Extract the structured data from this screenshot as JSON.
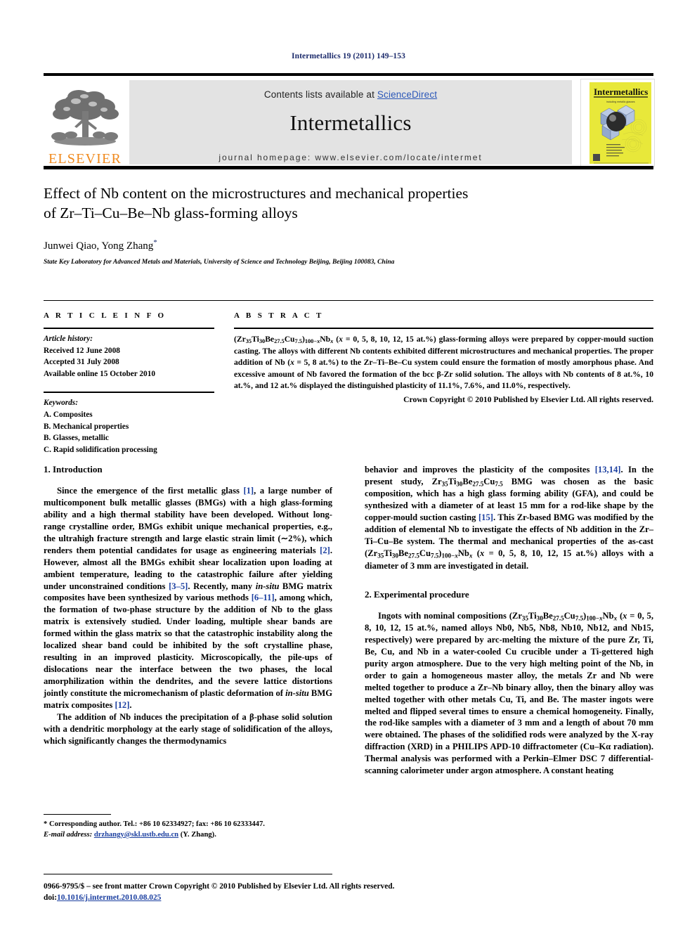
{
  "running_head": "Intermetallics 19 (2011) 149–153",
  "masthead": {
    "contents_prefix": "Contents lists available at ",
    "sciencedirect": "ScienceDirect",
    "journal_name": "Intermetallics",
    "homepage": "journal homepage: www.elsevier.com/locate/intermet",
    "publisher_logo_text": "ELSEVIER",
    "cover": {
      "title": "Intermetallics",
      "subtitle": "including metallic glasses",
      "bg_color": "#E8E83A",
      "cube_color": "#9DB3D8"
    }
  },
  "article": {
    "title_line1": "Effect of Nb content on the microstructures and mechanical properties",
    "title_line2": "of Zr–Ti–Cu–Be–Nb glass-forming alloys",
    "authors": "Junwei Qiao, Yong Zhang",
    "corresponding_marker": "*",
    "affiliation": "State Key Laboratory for Advanced Metals and Materials, University of Science and Technology Beijing, Beijing 100083, China"
  },
  "article_info": {
    "heading": "A R T I C L E    I N F O",
    "history_label": "Article history:",
    "history": [
      "Received 12 June 2008",
      "Accepted 31 July 2008",
      "Available online 15 October 2010"
    ],
    "keywords_label": "Keywords:",
    "keywords": [
      "A. Composites",
      "B. Mechanical properties",
      "B. Glasses, metallic",
      "C. Rapid solidification processing"
    ]
  },
  "abstract": {
    "heading": "A B S T R A C T",
    "copyright": "Crown Copyright © 2010 Published by Elsevier Ltd. All rights reserved."
  },
  "sections": {
    "intro_heading": "1. Introduction",
    "experimental_heading": "2. Experimental procedure"
  },
  "footnote": {
    "corresponding": "* Corresponding author. Tel.: +86 10 62334927; fax: +86 10 62333447.",
    "email_label": "E-mail address:",
    "email": "drzhangy@skl.ustb.edu.cn",
    "email_suffix": "(Y. Zhang)."
  },
  "footer": {
    "issn_line": "0966-9795/$ – see front matter Crown Copyright © 2010 Published by Elsevier Ltd. All rights reserved.",
    "doi_label": "doi:",
    "doi": "10.1016/j.intermet.2010.08.025"
  },
  "colors": {
    "link": "#1b3fa0",
    "sciencedirect": "#2b57b8",
    "elsevier_orange": "#F08A1E",
    "running_head": "#1b2a6b",
    "banner_gray": "#e3e3e3"
  }
}
